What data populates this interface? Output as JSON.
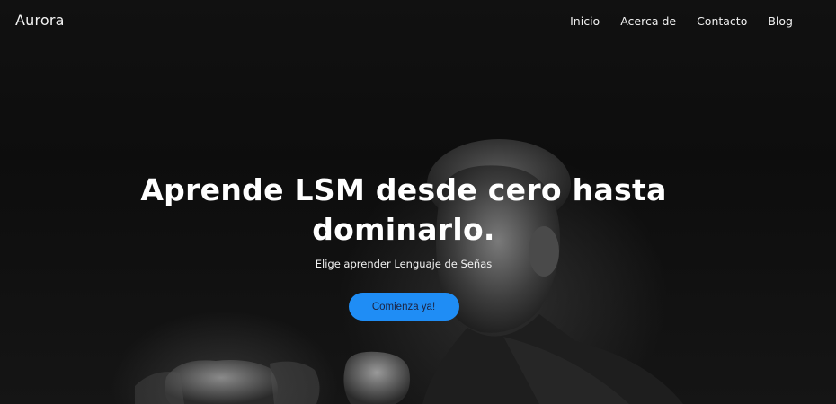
{
  "site": {
    "brand": "Aurora"
  },
  "nav": {
    "items": [
      {
        "label": "Inicio"
      },
      {
        "label": "Acerca de"
      },
      {
        "label": "Contacto"
      },
      {
        "label": "Blog"
      }
    ]
  },
  "hero": {
    "headline_line1": "Aprende LSM desde cero hasta",
    "headline_line2": "dominarlo.",
    "subtitle": "Elige aprender Lenguaje de Señas",
    "cta_label": "Comienza ya!",
    "cta_color": "#1f8df5",
    "background_image": "grayscale photo of young man signing with clenched hands"
  }
}
